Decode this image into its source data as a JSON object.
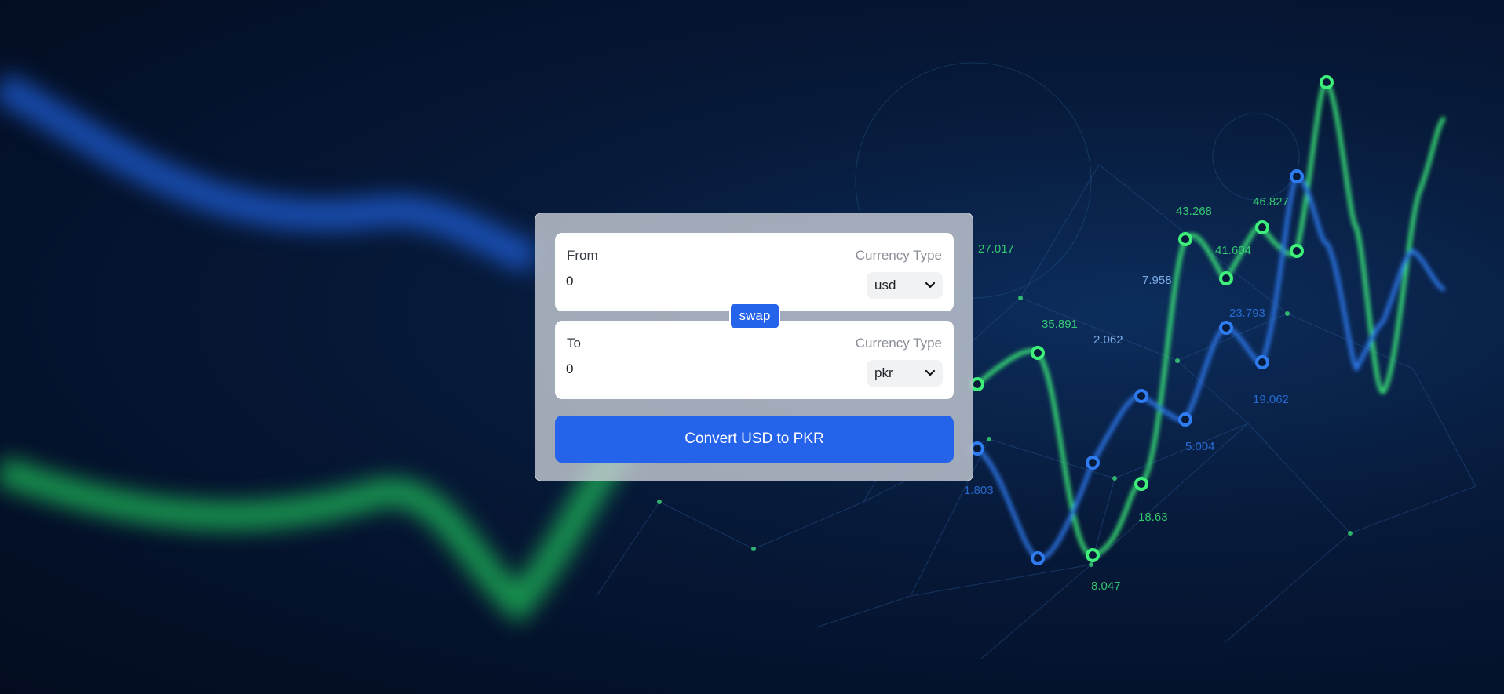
{
  "converter": {
    "from": {
      "label": "From",
      "currency_type_label": "Currency Type",
      "amount": "0",
      "selected_currency": "usd"
    },
    "swap_label": "swap",
    "to": {
      "label": "To",
      "currency_type_label": "Currency Type",
      "amount": "0",
      "selected_currency": "pkr"
    },
    "convert_label": "Convert USD to PKR"
  },
  "background": {
    "chart_labels": [
      "35.891",
      "27.017",
      "2.062",
      "7.958",
      "43.268",
      "41.604",
      "46.827",
      "23.793",
      "19.062",
      "5.004",
      "1.803",
      "18.63",
      "8.047"
    ]
  },
  "colors": {
    "accent": "#2563eb",
    "green_line": "#3ef07a",
    "blue_line": "#2f7bf0",
    "bg_dark": "#04112a"
  }
}
